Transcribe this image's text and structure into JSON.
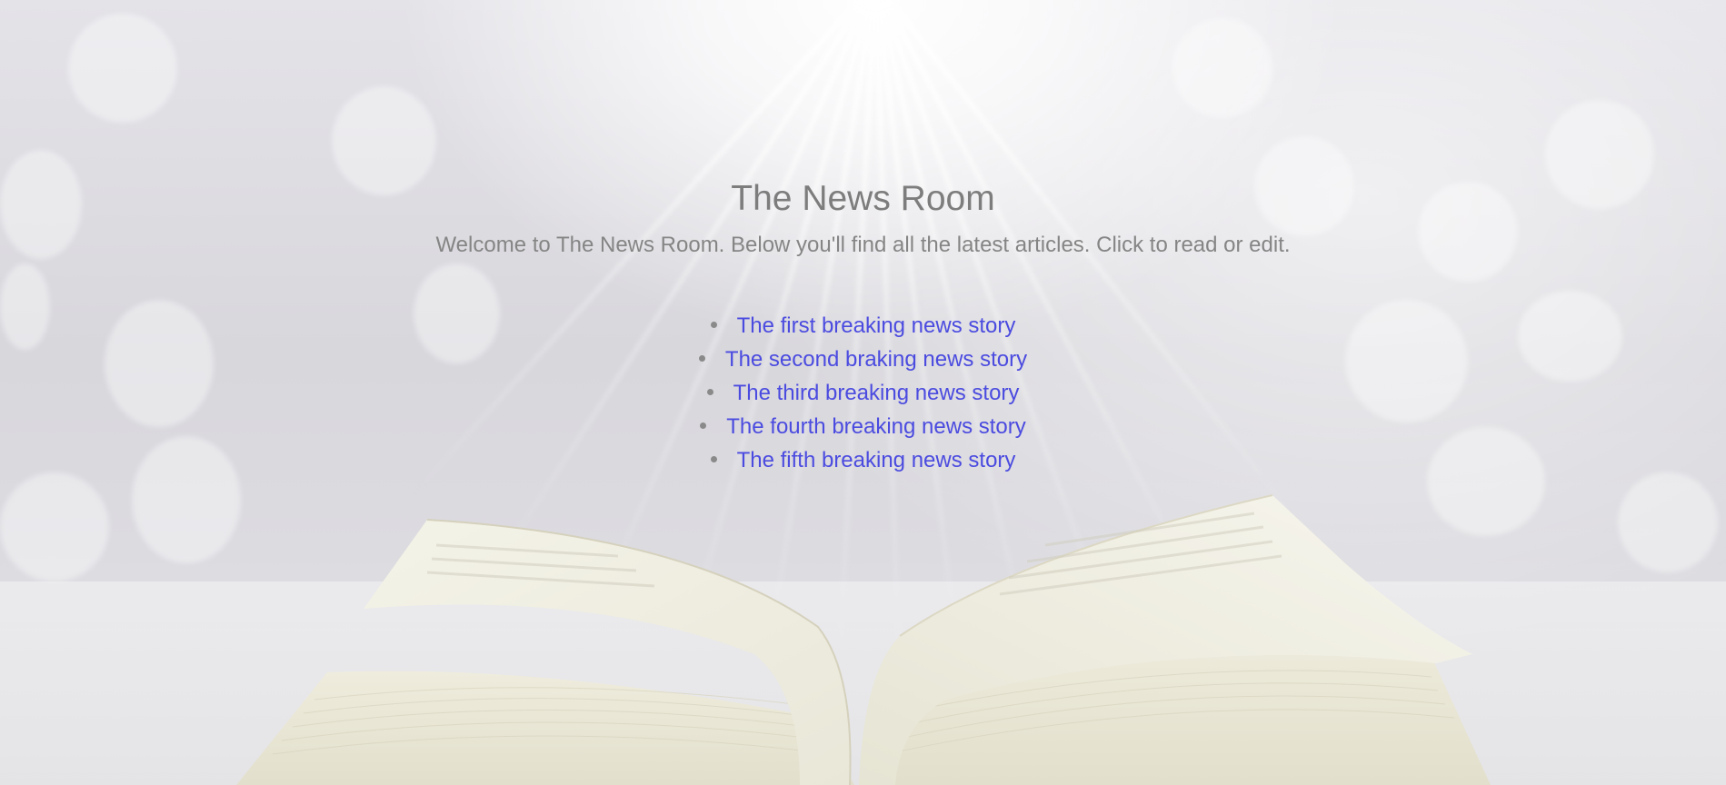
{
  "page": {
    "title": "The News Room",
    "subtitle": "Welcome to The News Room. Below you'll find all the latest articles. Click to read or edit."
  },
  "articles": [
    {
      "label": "The first breaking news story"
    },
    {
      "label": "The second braking news story"
    },
    {
      "label": "The third breaking news story"
    },
    {
      "label": "The fourth breaking news story"
    },
    {
      "label": "The fifth breaking news story"
    }
  ],
  "colors": {
    "heading": "#7d7d7d",
    "link": "#4b4be0",
    "background": "#d9d8dd"
  },
  "background_image": {
    "description_icon": "open-book-light-rays-background"
  }
}
